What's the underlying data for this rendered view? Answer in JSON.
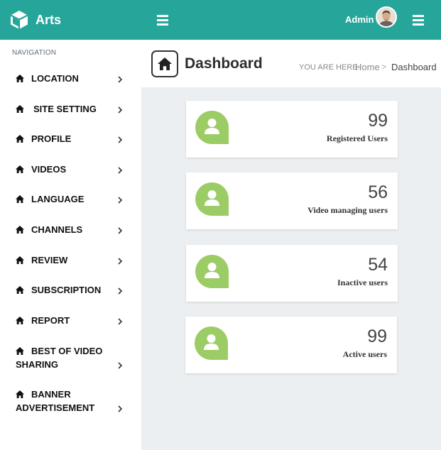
{
  "brand": {
    "name": "Arts",
    "logo_icon": "cube-icon"
  },
  "topbar": {
    "user_label": "Admin",
    "menu_icon": "hamburger-icon",
    "color": "#26a69a"
  },
  "sidebar": {
    "heading": "NAVIGATION",
    "items": [
      {
        "label": "LOCATION"
      },
      {
        "label": "SITE SETTING"
      },
      {
        "label": "PROFILE"
      },
      {
        "label": "VIDEOS"
      },
      {
        "label": "LANGUAGE"
      },
      {
        "label": "CHANNELS"
      },
      {
        "label": "REVIEW"
      },
      {
        "label": "SUBSCRIPTION"
      },
      {
        "label": "REPORT"
      },
      {
        "label_line1": "BEST OF VIDEO",
        "label_line2": "SHARING"
      },
      {
        "label_line1": "BANNER",
        "label_line2": "ADVERTISEMENT"
      }
    ]
  },
  "header": {
    "title": "Dashboard",
    "breadcrumb_prefix": "YOU ARE HERE:",
    "breadcrumb_home": "Home",
    "breadcrumb_separator": ">",
    "breadcrumb_current": "Dashboard"
  },
  "cards": [
    {
      "value": "99",
      "label": "Registered Users"
    },
    {
      "value": "56",
      "label": "Video managing users"
    },
    {
      "value": "54",
      "label": "Inactive users"
    },
    {
      "value": "99",
      "label": "Active users"
    }
  ],
  "colors": {
    "accent": "#26a69a",
    "card_icon": "#9ccc65",
    "content_bg": "#eceff1"
  }
}
